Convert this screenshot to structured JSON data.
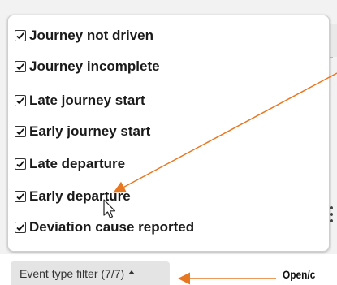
{
  "event_type_filter": {
    "options": [
      {
        "label": "Journey not driven",
        "checked": true
      },
      {
        "label": "Journey incomplete",
        "checked": true
      },
      {
        "label": "Late journey start",
        "checked": true
      },
      {
        "label": "Early journey start",
        "checked": true
      },
      {
        "label": "Late departure",
        "checked": true
      },
      {
        "label": "Early departure",
        "checked": true
      },
      {
        "label": "Deviation cause reported",
        "checked": true
      }
    ],
    "button_label": "Event type filter (7/7)",
    "button_caret": "caret-up"
  },
  "annotation": {
    "text": "Open/c",
    "color": "#e87722"
  },
  "colors": {
    "accent_orange": "#e87722",
    "dropdown_border": "#cfcfcf",
    "button_bg": "#e4e4e4"
  }
}
